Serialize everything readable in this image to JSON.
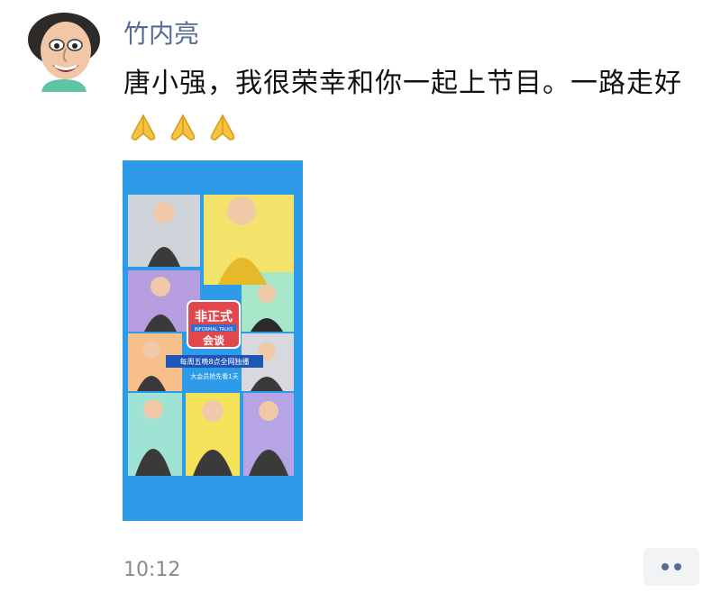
{
  "post": {
    "author": "竹内亮",
    "text": "唐小强，我很荣幸和你一起上节目。一路走好",
    "emoji": [
      "folded-hands",
      "folded-hands",
      "folded-hands"
    ],
    "timestamp": "10:12"
  },
  "poster": {
    "title_line1": "非正式",
    "title_line2": "会谈",
    "subtitle": "INFORMAL TALKS",
    "schedule": "每周五晚8点全网独播",
    "member_note": "大会员抢先看1天"
  },
  "colors": {
    "author_link": "#576b95",
    "poster_bg": "#2e9be8",
    "timestamp": "#8a8a8a"
  }
}
